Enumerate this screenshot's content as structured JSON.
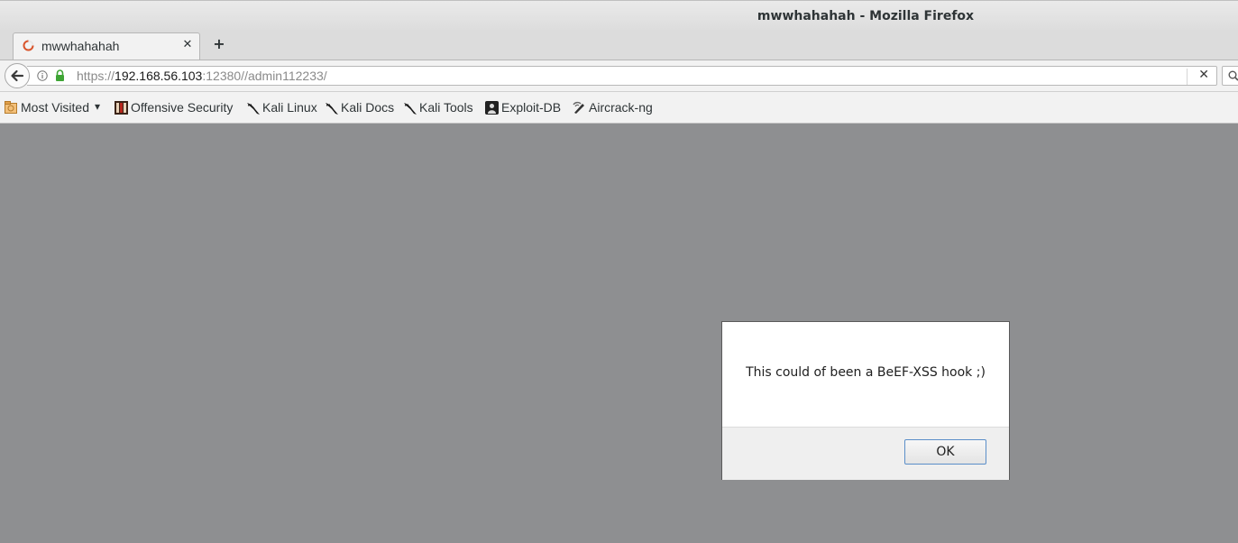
{
  "window": {
    "title": "mwwhahahah - Mozilla Firefox"
  },
  "tabs": [
    {
      "title": "mwwhahahah",
      "close_glyph": "✕"
    }
  ],
  "newtab": {
    "glyph": "+"
  },
  "navbar": {
    "url_scheme": "https://",
    "url_host": "192.168.56.103",
    "url_rest": ":12380//admin112233/",
    "clear_glyph": "✕"
  },
  "bookmarks": [
    {
      "label": "Most Visited",
      "icon": "most-visited-icon",
      "dropdown": "▾"
    },
    {
      "label": "Offensive Security",
      "icon": "offsec-icon"
    },
    {
      "label": "Kali Linux",
      "icon": "kali-dragon-icon"
    },
    {
      "label": "Kali Docs",
      "icon": "kali-dragon-icon"
    },
    {
      "label": "Kali Tools",
      "icon": "kali-dragon-icon"
    },
    {
      "label": "Exploit-DB",
      "icon": "exploitdb-icon"
    },
    {
      "label": "Aircrack-ng",
      "icon": "aircrack-icon"
    }
  ],
  "dialog": {
    "message": "This could of been a BeEF-XSS hook ;)",
    "ok_label": "OK"
  },
  "colors": {
    "content_bg": "#8e8f91",
    "lock_green": "#3fa535",
    "ok_border": "#5b8fc9"
  }
}
